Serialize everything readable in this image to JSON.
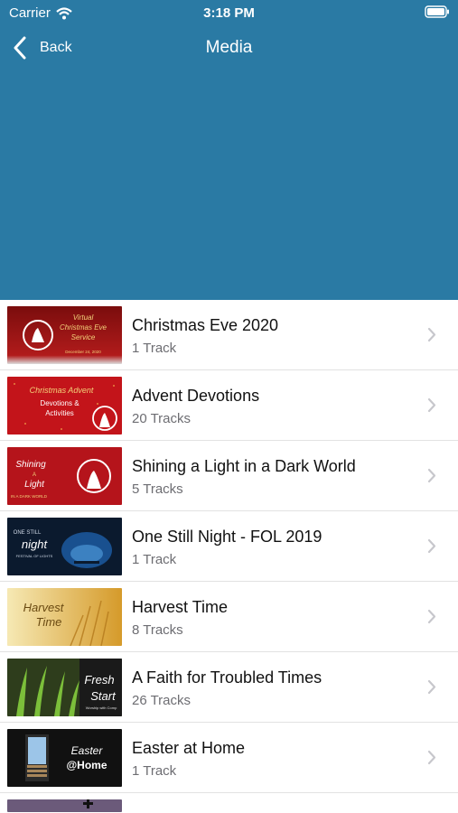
{
  "status": {
    "carrier": "Carrier",
    "time": "3:18 PM"
  },
  "nav": {
    "back_label": "Back",
    "title": "Media"
  },
  "colors": {
    "header": "#2a7aa4",
    "subtitle": "#6d6d72"
  },
  "items": [
    {
      "title": "Christmas Eve 2020",
      "subtitle": "1 Track",
      "thumb_text": [
        "Virtual",
        "Christmas Eve",
        "Service",
        "December 24, 2020"
      ]
    },
    {
      "title": "Advent Devotions",
      "subtitle": "20 Tracks",
      "thumb_text": [
        "Christmas Advent",
        "Devotions &",
        "Activities"
      ]
    },
    {
      "title": "Shining a Light in a Dark World",
      "subtitle": "5 Tracks",
      "thumb_text": [
        "Shining",
        "A",
        "Light",
        "IN A DARK WORLD"
      ]
    },
    {
      "title": "One Still Night - FOL 2019",
      "subtitle": "1 Track",
      "thumb_text": [
        "ONE STILL",
        "night",
        "FESTIVAL OF LIGHTS"
      ]
    },
    {
      "title": "Harvest Time",
      "subtitle": "8 Tracks",
      "thumb_text": [
        "Harvest",
        "Time"
      ]
    },
    {
      "title": "A Faith for Troubled Times",
      "subtitle": "26 Tracks",
      "thumb_text": [
        "Fresh",
        "Start",
        "Worship with Comp"
      ]
    },
    {
      "title": "Easter at Home",
      "subtitle": "1 Track",
      "thumb_text": [
        "Easter",
        "@Home"
      ]
    }
  ]
}
